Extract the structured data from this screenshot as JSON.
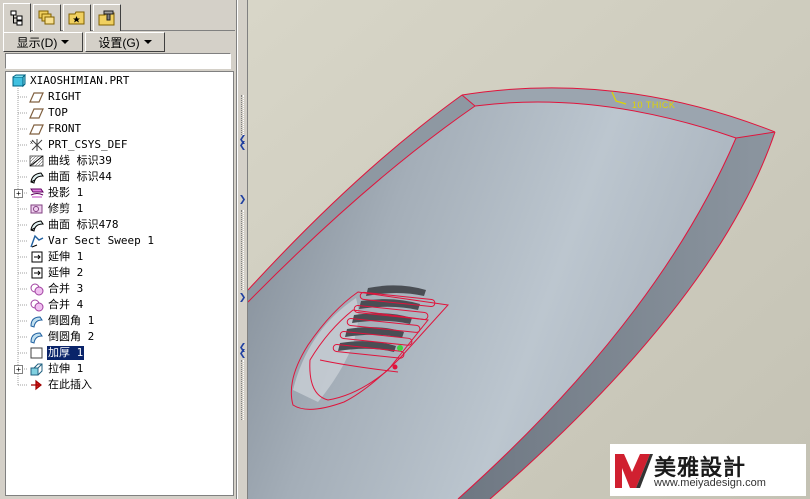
{
  "toolbar": {
    "display_label": "显示(D)",
    "settings_label": "设置(G)"
  },
  "tabs": [
    {
      "name": "model-tree",
      "active": true
    },
    {
      "name": "layers",
      "active": false
    },
    {
      "name": "favorites",
      "active": false
    },
    {
      "name": "tools",
      "active": false
    }
  ],
  "tree": {
    "items": [
      {
        "label": "XIAOSHIMIAN.PRT",
        "icon": "part-icon"
      },
      {
        "label": "RIGHT",
        "icon": "datum-plane-icon"
      },
      {
        "label": "TOP",
        "icon": "datum-plane-icon"
      },
      {
        "label": "FRONT",
        "icon": "datum-plane-icon"
      },
      {
        "label": "PRT_CSYS_DEF",
        "icon": "csys-icon"
      },
      {
        "label": "曲线 标识39",
        "icon": "curve-icon"
      },
      {
        "label": "曲面 标识44",
        "icon": "surface-icon"
      },
      {
        "label": "投影 1",
        "icon": "projection-icon"
      },
      {
        "label": "修剪 1",
        "icon": "trim-icon"
      },
      {
        "label": "曲面 标识478",
        "icon": "surface-icon"
      },
      {
        "label": "Var Sect Sweep 1",
        "icon": "sweep-icon"
      },
      {
        "label": "延伸 1",
        "icon": "extend-icon"
      },
      {
        "label": "延伸 2",
        "icon": "extend-icon"
      },
      {
        "label": "合并 3",
        "icon": "merge-icon"
      },
      {
        "label": "合并 4",
        "icon": "merge-icon"
      },
      {
        "label": "倒圆角 1",
        "icon": "round-icon"
      },
      {
        "label": "倒圆角 2",
        "icon": "round-icon"
      },
      {
        "label": "加厚 1",
        "icon": "thicken-icon",
        "selected": true
      },
      {
        "label": "拉伸 1",
        "icon": "extrude-icon"
      },
      {
        "label": "在此插入",
        "icon": "insert-here-icon"
      }
    ]
  },
  "viewport": {
    "annotation": "10 THICK",
    "colors": {
      "background": "#cfcdbf",
      "surface": "#a9b3bd",
      "edge": "#e0143c",
      "annotation": "#e0d400"
    }
  },
  "watermark": {
    "title": "美雅設計",
    "url": "www.meiyadesign.com"
  }
}
